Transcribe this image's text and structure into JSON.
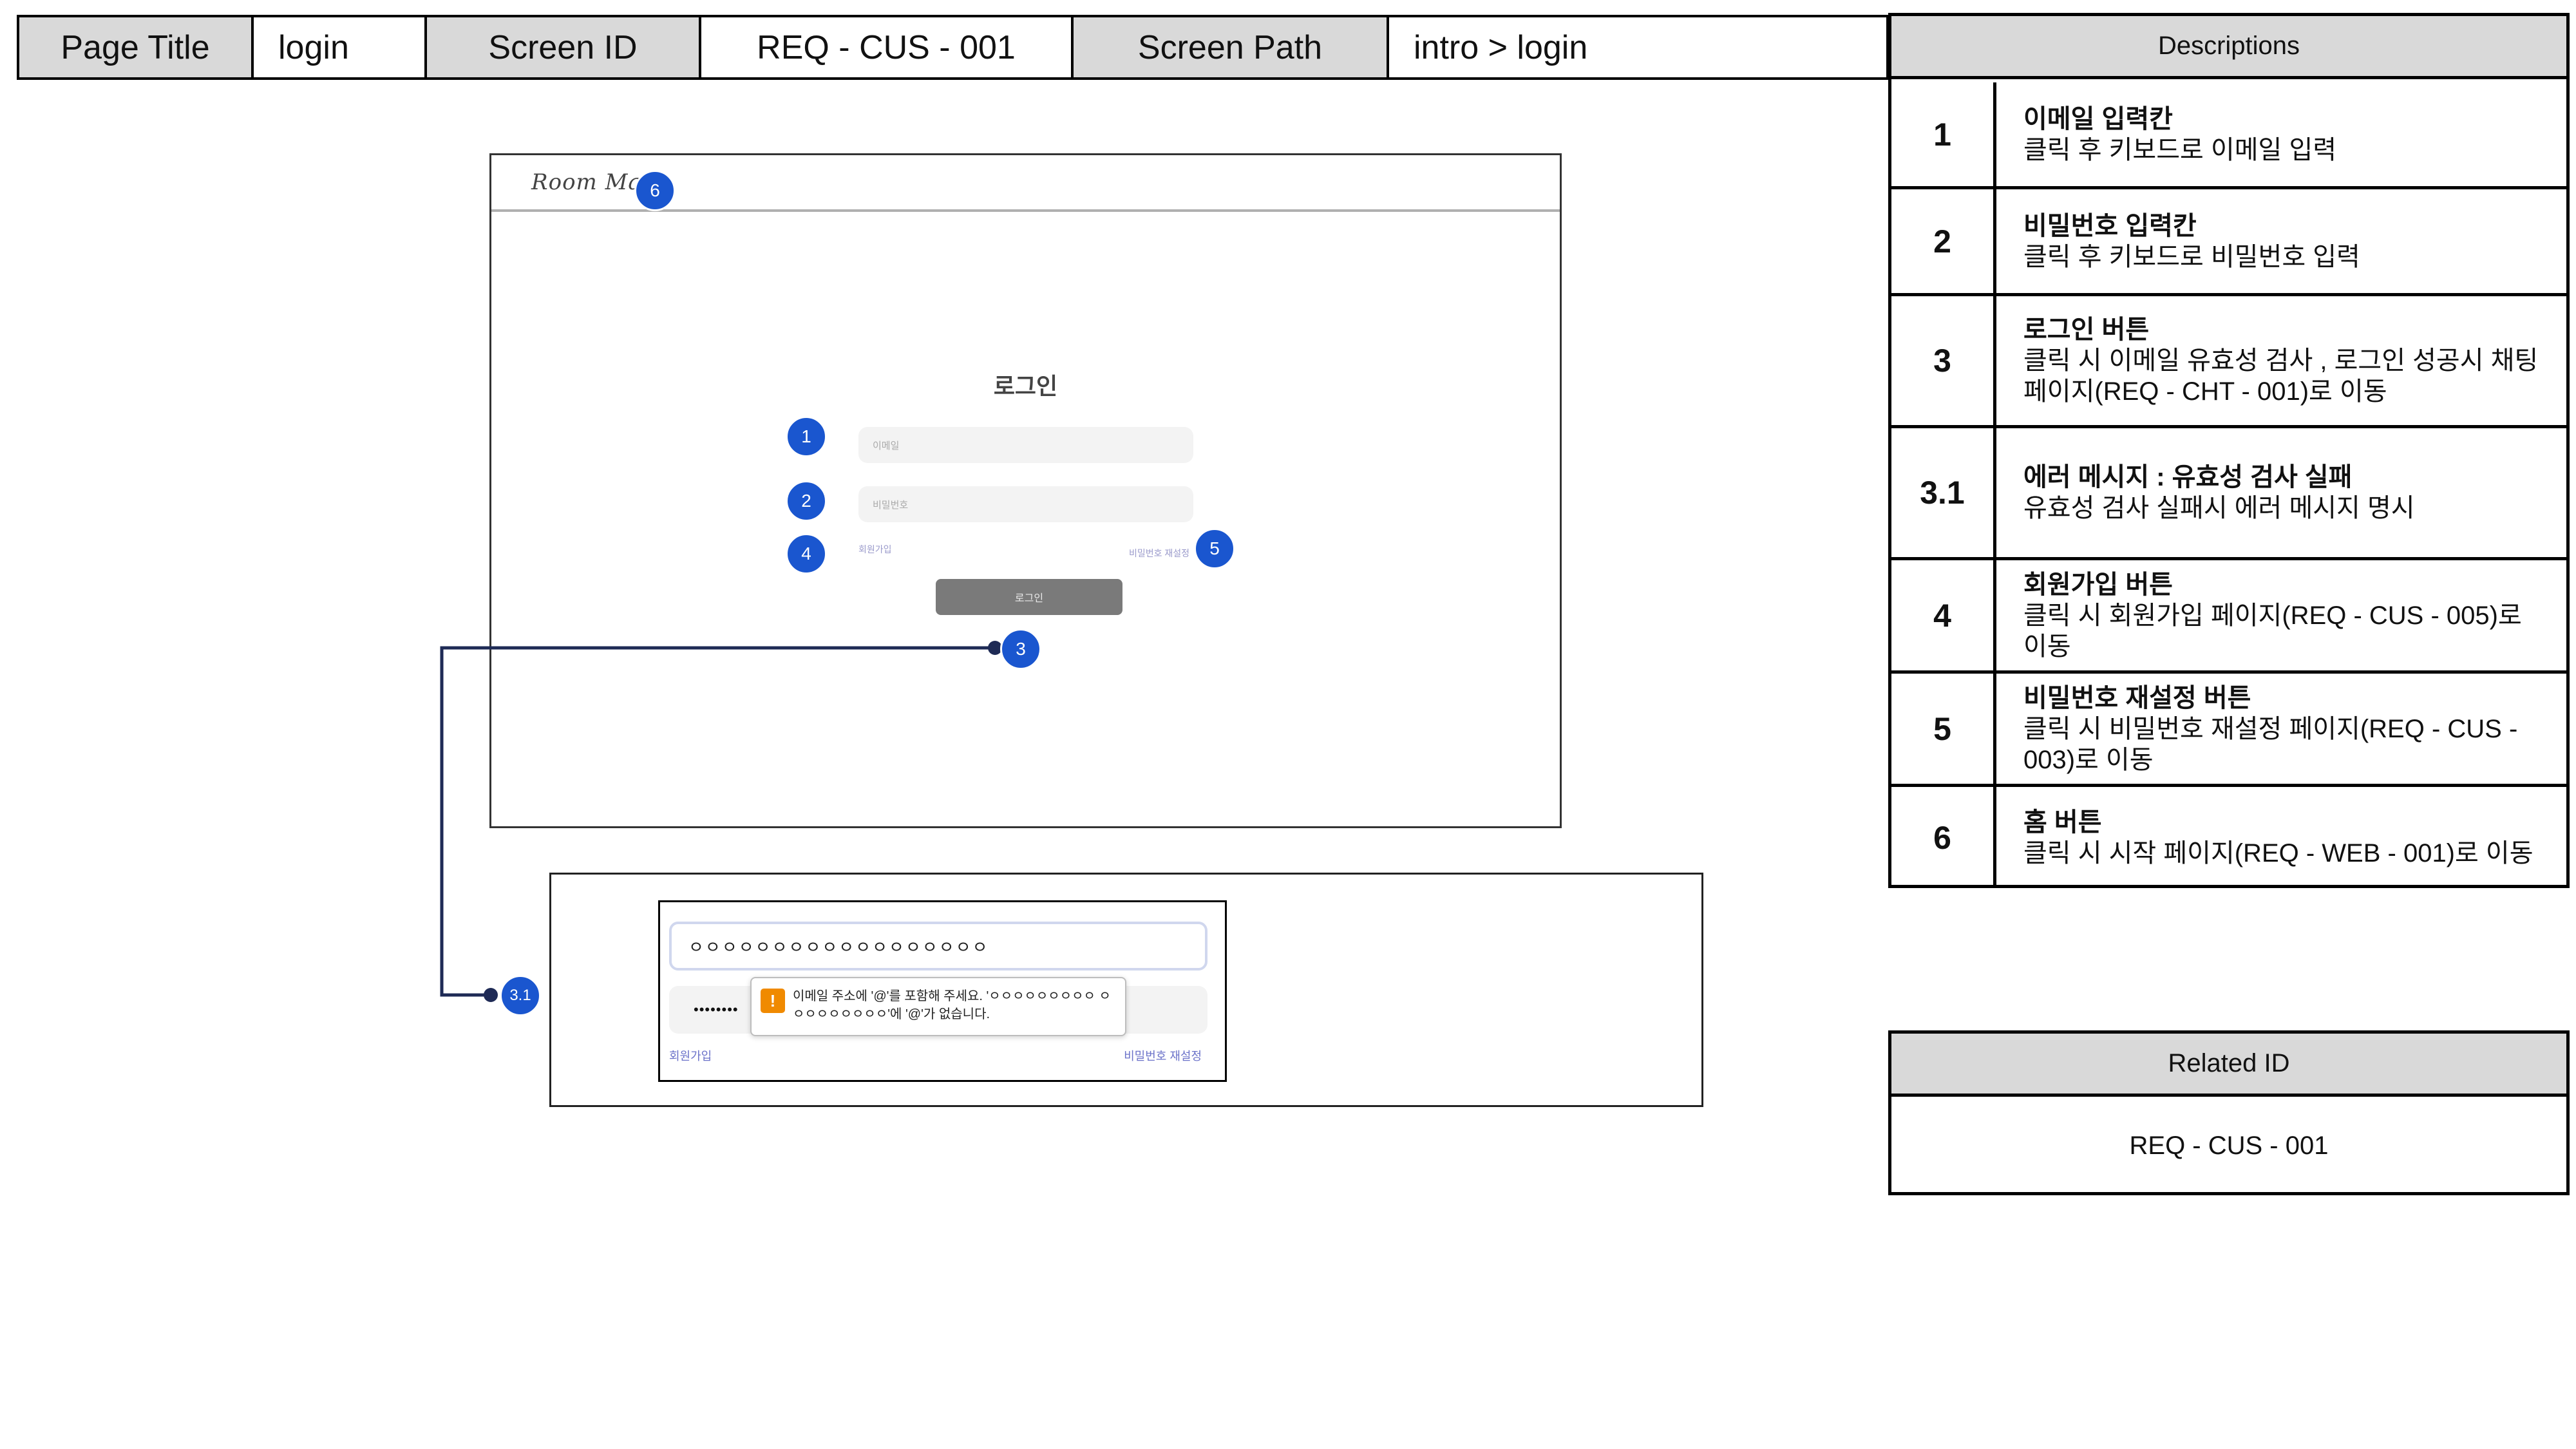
{
  "header": {
    "page_title_label": "Page Title",
    "page_title_value": "login",
    "screen_id_label": "Screen ID",
    "screen_id_value": "REQ - CUS - 001",
    "screen_path_label": "Screen Path",
    "screen_path_value": "intro > login"
  },
  "descriptions": {
    "heading": "Descriptions",
    "rows": [
      {
        "num": "1",
        "title": "이메일 입력칸",
        "body": "클릭 후 키보드로 이메일 입력"
      },
      {
        "num": "2",
        "title": "비밀번호 입력칸",
        "body": "클릭 후 키보드로 비밀번호 입력"
      },
      {
        "num": "3",
        "title": "로그인 버튼",
        "body": "클릭 시 이메일 유효성 검사 , 로그인 성공시 채팅 페이지(REQ - CHT - 001)로 이동"
      },
      {
        "num": "3.1",
        "title": "에러 메시지 : 유효성 검사 실패",
        "body": "유효성 검사 실패시 에러 메시지 명시"
      },
      {
        "num": "4",
        "title": "회원가입 버튼",
        "body": "클릭 시 회원가입 페이지(REQ - CUS - 005)로 이동"
      },
      {
        "num": "5",
        "title": "비밀번호 재설정 버튼",
        "body": "클릭 시 비밀번호 재설정 페이지(REQ - CUS - 003)로 이동"
      },
      {
        "num": "6",
        "title": "홈 버튼",
        "body": "클릭 시 시작 페이지(REQ - WEB - 001)로 이동"
      }
    ]
  },
  "related": {
    "heading": "Related ID",
    "value": "REQ - CUS - 001"
  },
  "mockup": {
    "logo": "Room Mate",
    "title": "로그인",
    "email_placeholder": "이메일",
    "password_placeholder": "비밀번호",
    "signup_link": "회원가입",
    "reset_link": "비밀번호 재설정",
    "login_button": "로그인"
  },
  "error_mockup": {
    "email_value": "ㅇㅇㅇㅇㅇㅇㅇㅇㅇㅇㅇㅇㅇㅇㅇㅇㅇㅇ",
    "password_value": "••••••••",
    "warn_symbol": "!",
    "tooltip_text": "이메일 주소에 '@'를 포함해 주세요. 'ㅇㅇㅇㅇㅇㅇㅇㅇㅇ ㅇㅇㅇㅇㅇㅇㅇㅇㅇ'에 '@'가 없습니다.",
    "signup_link": "회원가입",
    "reset_link": "비밀번호 재설정"
  },
  "badges": {
    "b1": "1",
    "b2": "2",
    "b3": "3",
    "b31": "3.1",
    "b4": "4",
    "b5": "5",
    "b6": "6"
  },
  "colors": {
    "badge": "#1a56cf",
    "header_fill": "#d9d9d9",
    "warning": "#f08a00",
    "link": "#6b72c9"
  }
}
